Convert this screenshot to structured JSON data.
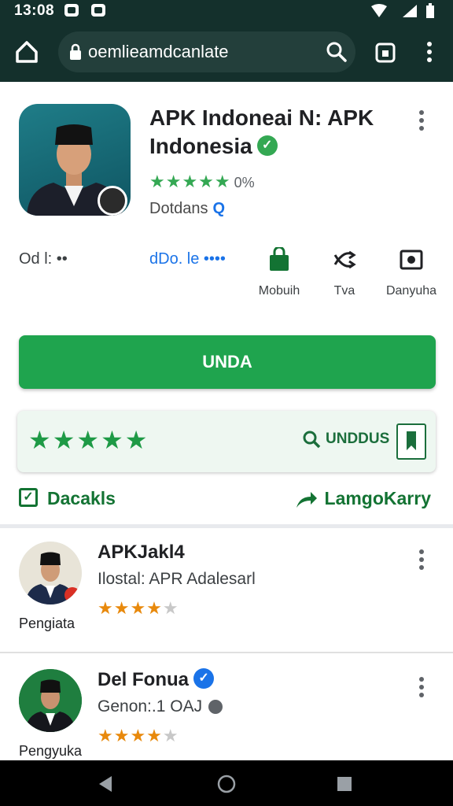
{
  "status": {
    "time": "13:08"
  },
  "browser": {
    "url": "oemlieamdcanlate"
  },
  "app": {
    "title": "APK Indoneai N: APK Indonesia",
    "rating_stars": "★★★★★",
    "rating_text": "0%",
    "developer": "Dotdans",
    "dev_icon_text": "Q",
    "meta_left": "Od l: ••",
    "meta_mid": "dDo. le ••••",
    "actions": [
      {
        "label": "Mobuih",
        "icon": "shopping-bag-icon"
      },
      {
        "label": "Tva",
        "icon": "shuffle-icon"
      },
      {
        "label": "Danyuha",
        "icon": "image-frame-icon"
      }
    ],
    "install_label": "UNDA",
    "rate_stars": "★★★★★",
    "download_label": "UNDDUS",
    "details_label": "Dacakls",
    "share_label": "LamgoKarry"
  },
  "list": [
    {
      "title": "APKJakl4",
      "subtitle": "Ilostal: APR Adalesarl",
      "caption": "Pengiata",
      "stars_on": "★★★★",
      "stars_off": "★"
    },
    {
      "title": "Del Fonua",
      "subtitle": "Genon:.1 OAJ",
      "caption": "Pengyuka",
      "stars_on": "★★★★",
      "stars_off": "★"
    }
  ],
  "colors": {
    "accent": "#1fa44e",
    "header": "#14302c",
    "star_orange": "#e8890c"
  }
}
